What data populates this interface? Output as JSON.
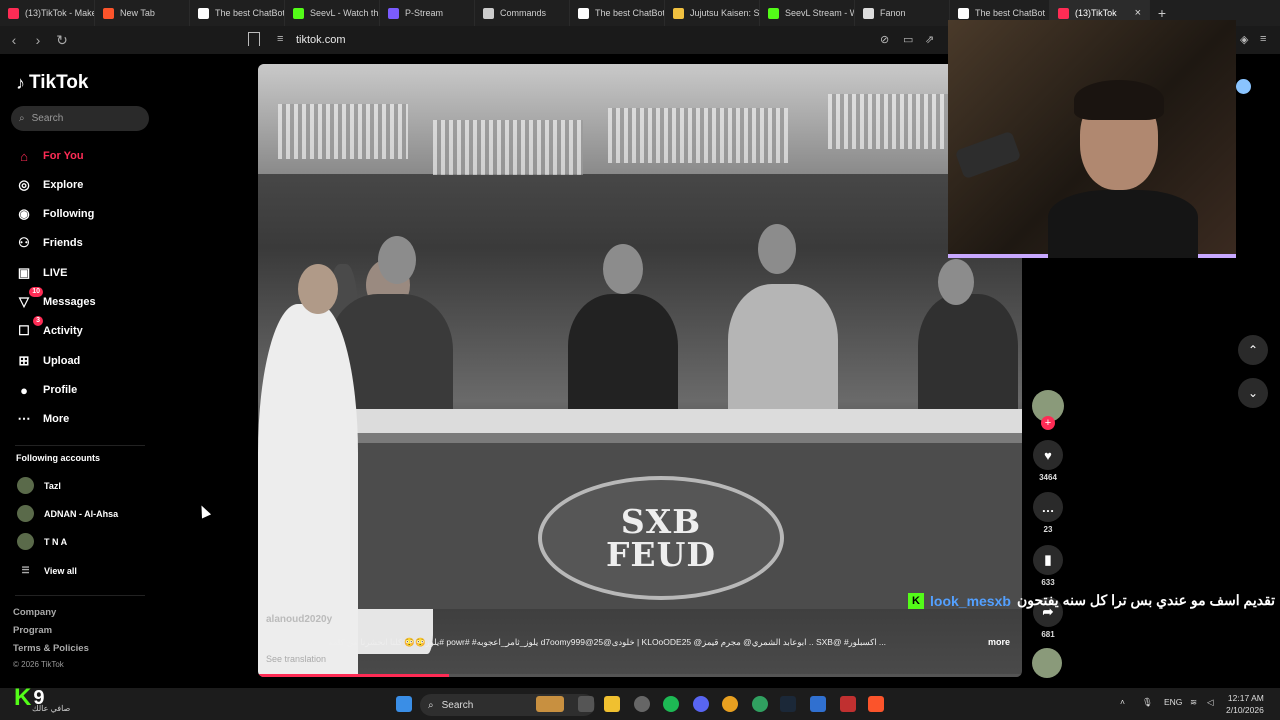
{
  "browser": {
    "tabs": [
      {
        "label": "(13)TikTok - Make",
        "color": "#fe2c55"
      },
      {
        "label": "New Tab",
        "color": "#fb542b"
      },
      {
        "label": "The best ChatBot",
        "color": "#ffffff"
      },
      {
        "label": "SeevL - Watch th",
        "color": "#53fc18"
      },
      {
        "label": "P-Stream",
        "color": "#7b5cff"
      },
      {
        "label": "Commands",
        "color": "#cccccc"
      },
      {
        "label": "The best ChatBot",
        "color": "#ffffff"
      },
      {
        "label": "Jujutsu Kaisen: Sh",
        "color": "#f0c040"
      },
      {
        "label": "SeevL Stream - W",
        "color": "#53fc18"
      },
      {
        "label": "Fanon",
        "color": "#dddddd"
      },
      {
        "label": "The best ChatBot",
        "color": "#ffffff"
      },
      {
        "label": "(13)TikTok",
        "color": "#fe2c55",
        "active": true
      }
    ],
    "new_tab_label": "+",
    "url": "tiktok.com"
  },
  "sidebar": {
    "logo": "TikTok",
    "search_placeholder": "Search",
    "nav": [
      {
        "label": "For You",
        "icon": "home-icon",
        "active": true
      },
      {
        "label": "Explore",
        "icon": "compass-icon"
      },
      {
        "label": "Following",
        "icon": "following-icon"
      },
      {
        "label": "Friends",
        "icon": "friends-icon"
      },
      {
        "label": "LIVE",
        "icon": "live-icon"
      },
      {
        "label": "Messages",
        "icon": "messages-icon",
        "badge": "10"
      },
      {
        "label": "Activity",
        "icon": "activity-icon",
        "badge": "3"
      },
      {
        "label": "Upload",
        "icon": "upload-icon"
      },
      {
        "label": "Profile",
        "icon": "profile-icon"
      },
      {
        "label": "More",
        "icon": "more-icon"
      }
    ],
    "following_title": "Following accounts",
    "accounts": [
      "Tazl",
      "ADNAN - Al-Ahsa",
      "T N A"
    ],
    "view_all": "View all",
    "footer": [
      "Company",
      "Program",
      "Terms & Policies"
    ],
    "copyright": "© 2026 TikTok"
  },
  "video": {
    "sign_line1": "SXB",
    "sign_line2": "FEUD",
    "username": "alanoud2020y",
    "caption": "... اكسبلور# @SXB .. ابوعابد الشمري@ مجرم قيمز@ KLOoODE25 | خلودى@d7oomy999@25 يلوز_ثامر_اعجوبه# #powr #يلوز😳😳 كلنا انحشرنا من كلمه",
    "more": "more",
    "see_translation": "See translation",
    "progress": 0.25
  },
  "actions": {
    "likes": "3464",
    "comments": "23",
    "saves": "633",
    "shares": "681"
  },
  "chat_overlay": {
    "platform_badge": "K",
    "username": "look_mesxb",
    "message": "تقديم اسف مو عندي بس ترا كل سنه يفتحون"
  },
  "taskbar": {
    "search_label": "Search",
    "lang": "ENG",
    "time": "12:17 AM",
    "date": "2/10/2026"
  },
  "kick_widget": {
    "count": "9",
    "sub": "صافي عالك"
  }
}
